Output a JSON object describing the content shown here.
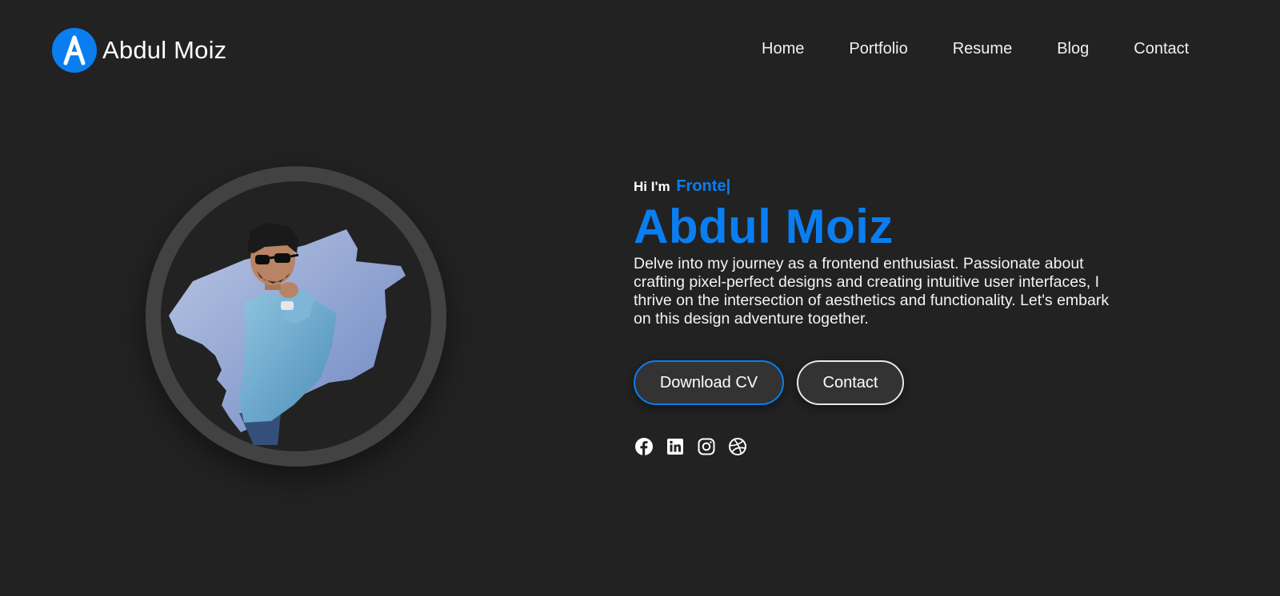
{
  "header": {
    "logo_letter": "A",
    "brand_name": "Abdul Moiz",
    "nav": [
      "Home",
      "Portfolio",
      "Resume",
      "Blog",
      "Contact"
    ]
  },
  "hero": {
    "greeting": "Hi I'm",
    "role_typed": "Fronte",
    "cursor": "|",
    "name": "Abdul Moiz",
    "intro": "Delve into my journey as a frontend enthusiast. Passionate about crafting pixel-perfect designs and creating intuitive user interfaces, I thrive on the intersection of aesthetics and functionality. Let's embark on this design adventure together.",
    "buttons": {
      "download_cv": "Download CV",
      "contact": "Contact"
    },
    "socials": [
      "facebook-icon",
      "linkedin-icon",
      "instagram-icon",
      "dribbble-icon"
    ]
  },
  "colors": {
    "background": "#222222",
    "accent": "#0a7ef0",
    "ring": "#424242",
    "button_bg": "#333333"
  }
}
